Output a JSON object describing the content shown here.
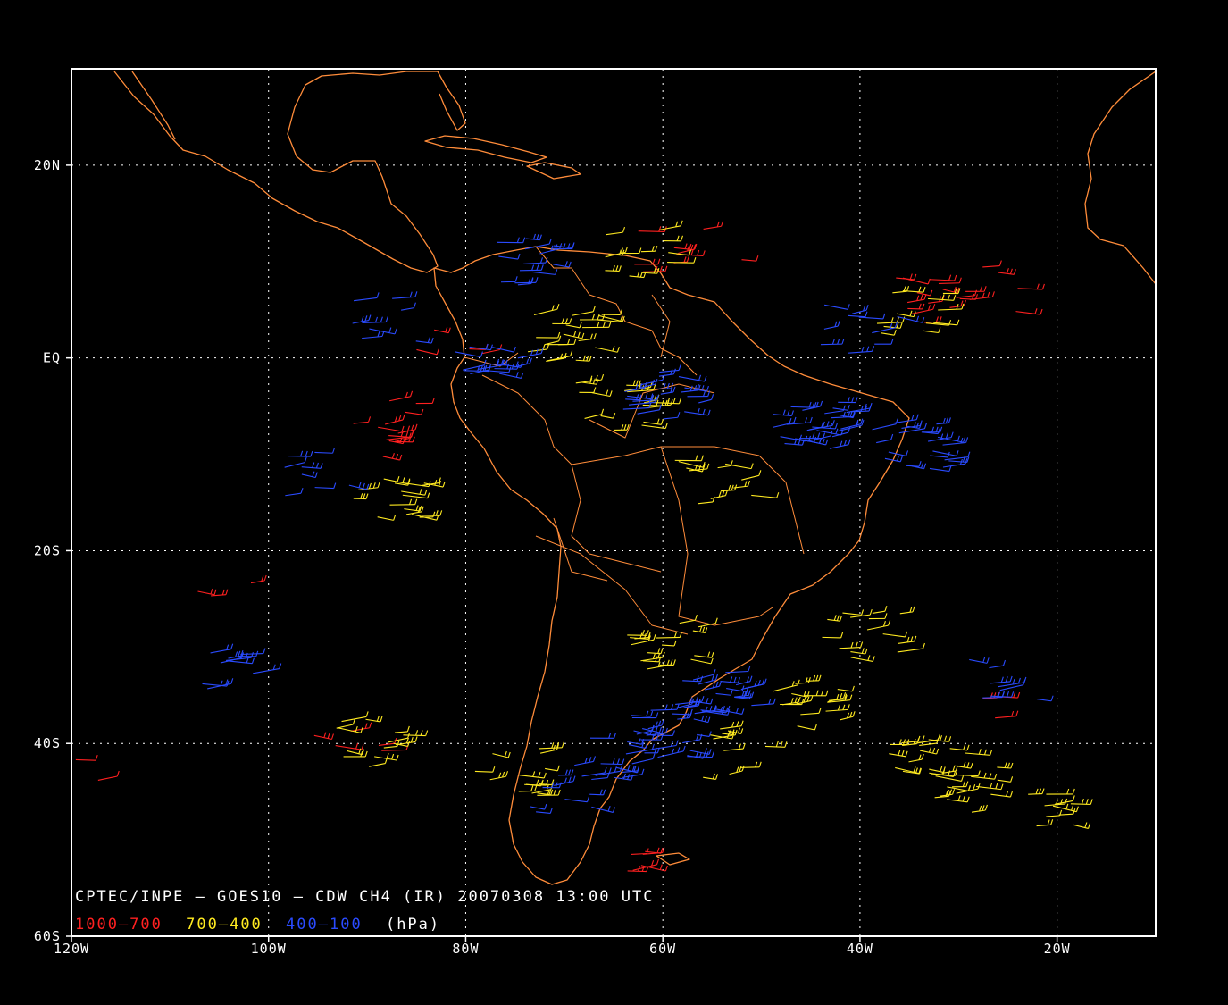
{
  "map": {
    "lon_labels": [
      "120W",
      "100W",
      "80W",
      "60W",
      "40W",
      "20W"
    ],
    "lat_labels": [
      "20N",
      "EQ",
      "20S",
      "40S",
      "60S"
    ],
    "lon_range": [
      -120,
      -10
    ],
    "lat_range": [
      -60,
      30
    ],
    "grid": true,
    "coastline_color": "#ff8c3a"
  },
  "caption": {
    "title": "CPTEC/INPE — GOES10 — CDW CH4 (IR) 20070308 13:00 UTC",
    "legend": [
      {
        "text": "1000—700",
        "color": "#ff2020"
      },
      {
        "text": "700—400",
        "color": "#ffea20"
      },
      {
        "text": "400—100",
        "color": "#2a4bff"
      }
    ],
    "unit": "(hPa)"
  },
  "wind_layers": [
    {
      "name": "1000—700",
      "color": "#ff2020",
      "clusters": [
        {
          "lon": -33,
          "lat": 6,
          "n": 14
        },
        {
          "lon": -28,
          "lat": 7,
          "n": 6
        },
        {
          "lon": -85,
          "lat": -7,
          "n": 8
        },
        {
          "lon": -88,
          "lat": -9,
          "n": 5
        },
        {
          "lon": -62,
          "lat": 11,
          "n": 6
        },
        {
          "lon": -56,
          "lat": 11,
          "n": 3
        },
        {
          "lon": -105,
          "lat": -23,
          "n": 3
        },
        {
          "lon": -60,
          "lat": -52,
          "n": 6
        },
        {
          "lon": -82,
          "lat": 2,
          "n": 4
        },
        {
          "lon": -28,
          "lat": -35,
          "n": 3
        },
        {
          "lon": -92,
          "lat": -41,
          "n": 5
        },
        {
          "lon": -118,
          "lat": -43,
          "n": 2
        }
      ]
    },
    {
      "name": "700—400",
      "color": "#ffea20",
      "clusters": [
        {
          "lon": -60,
          "lat": -30,
          "n": 16
        },
        {
          "lon": -40,
          "lat": -29,
          "n": 14
        },
        {
          "lon": -33,
          "lat": -42,
          "n": 18
        },
        {
          "lon": -30,
          "lat": -45,
          "n": 14
        },
        {
          "lon": -35,
          "lat": 5,
          "n": 12
        },
        {
          "lon": -70,
          "lat": 2,
          "n": 20
        },
        {
          "lon": -65,
          "lat": -5,
          "n": 16
        },
        {
          "lon": -88,
          "lat": -15,
          "n": 16
        },
        {
          "lon": -90,
          "lat": -40,
          "n": 14
        },
        {
          "lon": -75,
          "lat": -43,
          "n": 14
        },
        {
          "lon": -55,
          "lat": -13,
          "n": 12
        },
        {
          "lon": -45,
          "lat": -36,
          "n": 16
        },
        {
          "lon": -20,
          "lat": -47,
          "n": 10
        },
        {
          "lon": -63,
          "lat": 11,
          "n": 12
        },
        {
          "lon": -52,
          "lat": -41,
          "n": 10
        }
      ]
    },
    {
      "name": "400—100",
      "color": "#2a4bff",
      "clusters": [
        {
          "lon": -45,
          "lat": -7,
          "n": 26
        },
        {
          "lon": -35,
          "lat": -9,
          "n": 22
        },
        {
          "lon": -60,
          "lat": -4,
          "n": 20
        },
        {
          "lon": -55,
          "lat": -35,
          "n": 26
        },
        {
          "lon": -60,
          "lat": -39,
          "n": 18
        },
        {
          "lon": -65,
          "lat": -41,
          "n": 14
        },
        {
          "lon": -105,
          "lat": -32,
          "n": 10
        },
        {
          "lon": -75,
          "lat": 10,
          "n": 14
        },
        {
          "lon": -95,
          "lat": -12,
          "n": 8
        },
        {
          "lon": -25,
          "lat": -33,
          "n": 8
        },
        {
          "lon": -78,
          "lat": -1,
          "n": 14
        },
        {
          "lon": -70,
          "lat": -45,
          "n": 10
        },
        {
          "lon": -40,
          "lat": 3,
          "n": 10
        },
        {
          "lon": -88,
          "lat": 4,
          "n": 8
        }
      ]
    }
  ]
}
